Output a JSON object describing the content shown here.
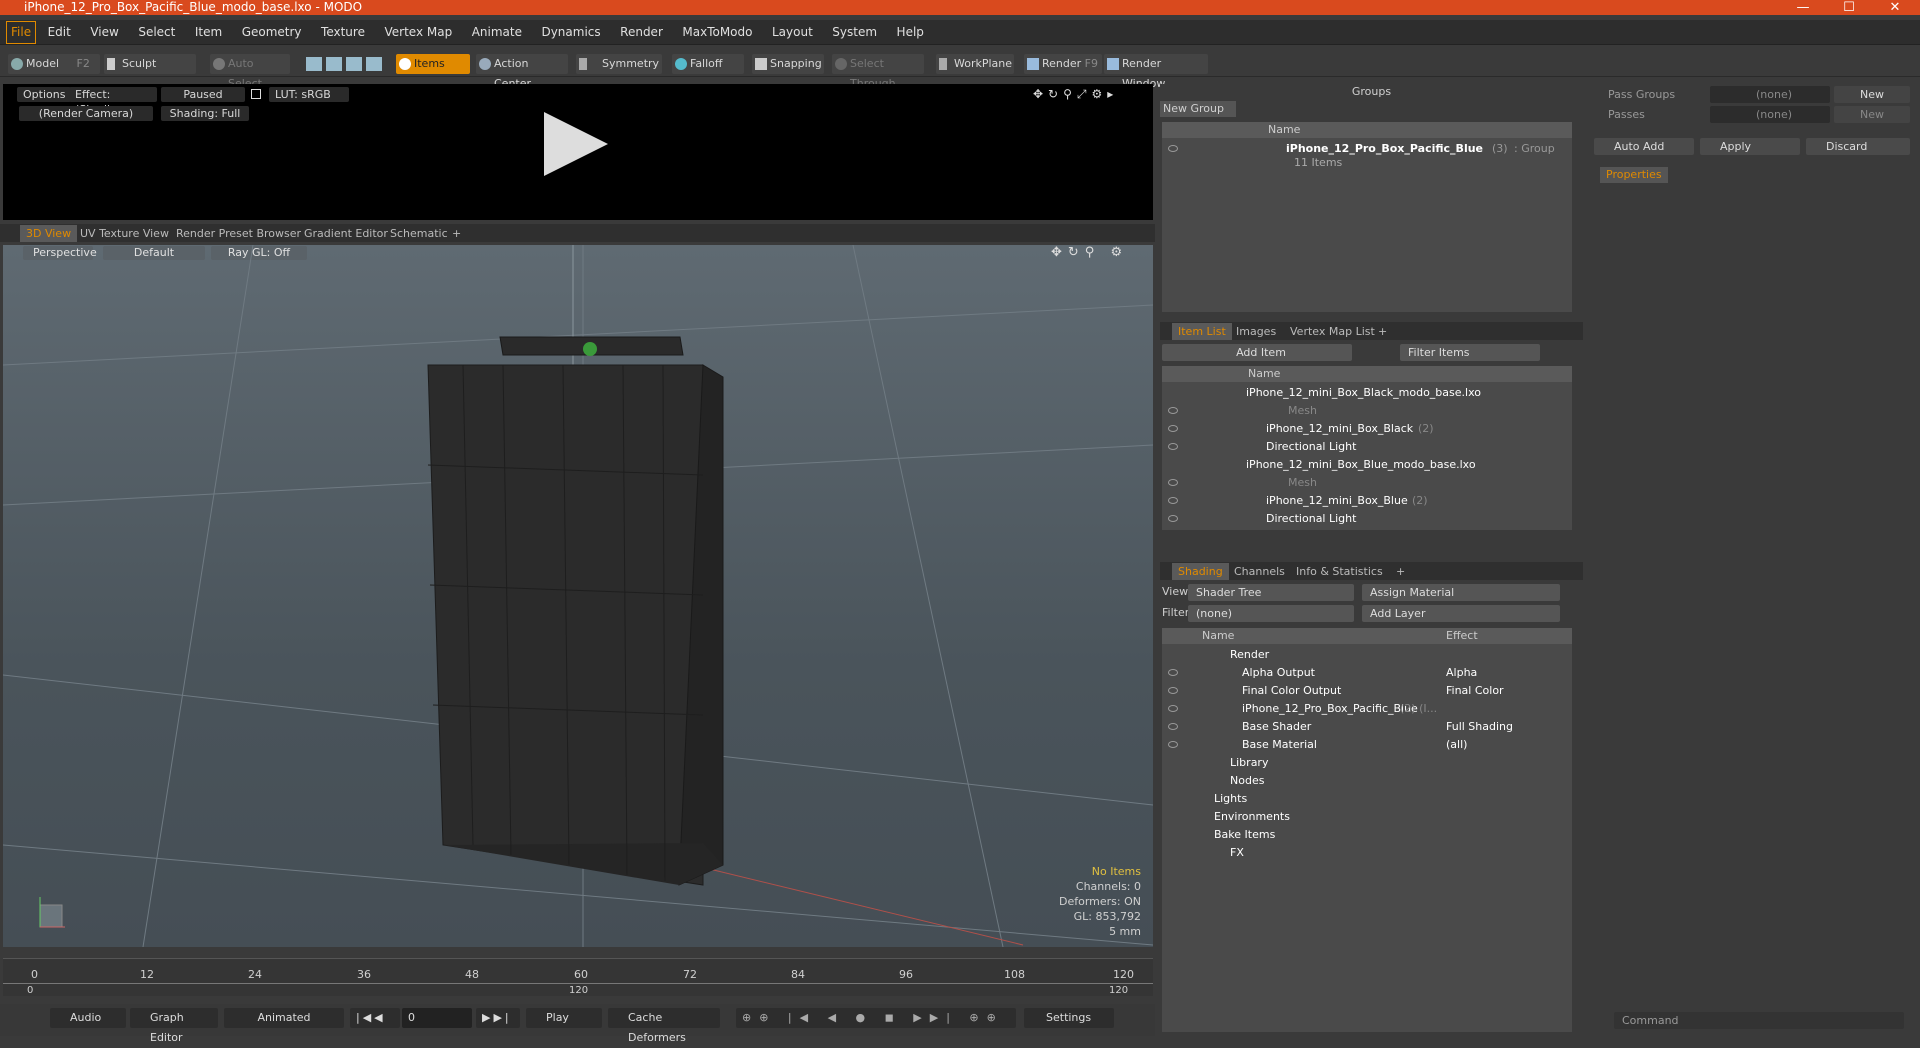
{
  "window": {
    "title": "iPhone_12_Pro_Box_Pacific_Blue_modo_base.lxo - MODO",
    "min": "—",
    "max": "☐",
    "close": "✕"
  },
  "menu": [
    "File",
    "Edit",
    "View",
    "Select",
    "Item",
    "Geometry",
    "Texture",
    "Vertex Map",
    "Animate",
    "Dynamics",
    "Render",
    "MaxToModo",
    "Layout",
    "System",
    "Help"
  ],
  "toolbar": {
    "model": "Model",
    "model_key": "F2",
    "sculpt": "Sculpt",
    "auto_select": "Auto Select",
    "items": "Items",
    "action_center": "Action Center",
    "symmetry": "Symmetry",
    "falloff": "Falloff",
    "snapping": "Snapping",
    "select_through": "Select Through",
    "workplane": "WorkPlane",
    "render": "Render",
    "render_key": "F9",
    "render_window": "Render Window"
  },
  "preview": {
    "options": "Options",
    "effect": "Effect: (Shadi...",
    "paused": "Paused",
    "lut": "LUT: sRGB",
    "camera": "(Render Camera)",
    "shading": "Shading: Full"
  },
  "view_tabs": [
    "3D View",
    "UV Texture View",
    "Render Preset Browser",
    "Gradient Editor",
    "Schematic",
    "+"
  ],
  "view3d": {
    "perspective": "Perspective",
    "default": "Default",
    "raygl": "Ray GL: Off",
    "stats": {
      "items": "No Items",
      "channels": "Channels: 0",
      "deformers": "Deformers: ON",
      "gl": "GL: 853,792",
      "unit": "5 mm"
    }
  },
  "timeline": {
    "ticks": [
      "0",
      "12",
      "24",
      "36",
      "48",
      "60",
      "72",
      "84",
      "96",
      "108",
      "120"
    ],
    "bottom": [
      "0",
      "120",
      "120"
    ]
  },
  "bottom": {
    "audio": "Audio",
    "graph": "Graph Editor",
    "animated": "Animated",
    "frame": "0",
    "play": "Play",
    "cache": "Cache Deformers",
    "settings": "Settings"
  },
  "groups": {
    "title": "Groups",
    "new_group": "New Group",
    "col_name": "Name",
    "item_name": "iPhone_12_Pro_Box_Pacific_Blue",
    "item_count": "(3)",
    "item_type": ": Group",
    "item_sub": "11 Items"
  },
  "itemlist": {
    "tabs": [
      "Item List",
      "Images",
      "Vertex Map List",
      "+"
    ],
    "add_item": "Add Item",
    "filter": "Filter Items",
    "col_name": "Name",
    "rows": [
      {
        "label": "iPhone_12_mini_Box_Black_modo_base.lxo",
        "indent": 0
      },
      {
        "label": "Mesh",
        "indent": 2,
        "dim": true
      },
      {
        "label": "iPhone_12_mini_Box_Black",
        "suffix": "(2)",
        "indent": 1
      },
      {
        "label": "Directional Light",
        "indent": 1
      },
      {
        "label": "iPhone_12_mini_Box_Blue_modo_base.lxo",
        "indent": 0
      },
      {
        "label": "Mesh",
        "indent": 2,
        "dim": true
      },
      {
        "label": "iPhone_12_mini_Box_Blue",
        "suffix": "(2)",
        "indent": 1
      },
      {
        "label": "Directional Light",
        "indent": 1
      }
    ]
  },
  "shading": {
    "tabs": [
      "Shading",
      "Channels",
      "Info & Statistics",
      "+"
    ],
    "view_label": "View",
    "view_value": "Shader Tree",
    "assign": "Assign Material",
    "filter_label": "Filter",
    "filter_value": "(none)",
    "add_layer": "Add Layer",
    "col_name": "Name",
    "col_effect": "Effect",
    "rows": [
      {
        "name": "Render",
        "effect": ""
      },
      {
        "name": "Alpha Output",
        "effect": "Alpha"
      },
      {
        "name": "Final Color Output",
        "effect": "Final Color"
      },
      {
        "name": "iPhone_12_Pro_Box_Pacific_Blue",
        "suffix": "(2) (I...",
        "effect": ""
      },
      {
        "name": "Base Shader",
        "effect": "Full Shading"
      },
      {
        "name": "Base Material",
        "effect": "(all)"
      },
      {
        "name": "Library",
        "effect": ""
      },
      {
        "name": "Nodes",
        "effect": ""
      },
      {
        "name": "Lights",
        "effect": ""
      },
      {
        "name": "Environments",
        "effect": ""
      },
      {
        "name": "Bake Items",
        "effect": ""
      },
      {
        "name": "FX",
        "effect": ""
      }
    ]
  },
  "props": {
    "pass_groups": "Pass Groups",
    "passes": "Passes",
    "none": "(none)",
    "new": "New",
    "auto_add": "Auto Add",
    "apply": "Apply",
    "discard": "Discard",
    "properties": "Properties",
    "command": "Command"
  }
}
